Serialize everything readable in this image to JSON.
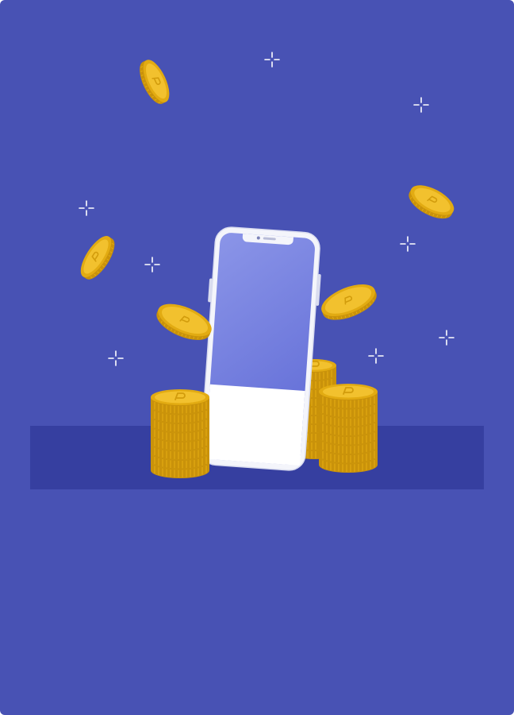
{
  "colors": {
    "background": "#4852b4",
    "floor_band": "#363fa0",
    "phone_frame": "#f4f5fb",
    "phone_bezel": "#d9dcef",
    "phone_screen_top": "#8b95e8",
    "phone_screen_bottom": "#6570d8",
    "phone_screen_lower": "#ffffff",
    "coin_face": "#f2c12e",
    "coin_rim": "#e2ab12",
    "coin_edge": "#c9920a",
    "coin_highlight": "#fbd85a",
    "coin_mark": "#d29c0c",
    "sparkle": "#ffffff"
  },
  "icons": {
    "phone": "smartphone-icon",
    "coin": "coin-icon",
    "coin_stack": "coin-stack-icon",
    "sparkle": "sparkle-icon"
  }
}
